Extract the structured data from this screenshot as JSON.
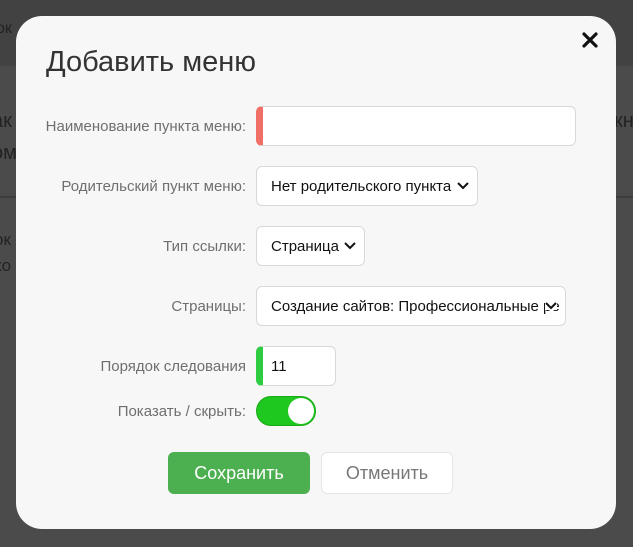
{
  "background": {
    "fragments": [
      "ок",
      "ак",
      "ом",
      "ок",
      "ко",
      "кн"
    ]
  },
  "modal": {
    "title": "Добавить меню",
    "close_icon": "close-icon"
  },
  "form": {
    "name_label": "Наименование пункта меню:",
    "name_value": "",
    "parent_label": "Родительский пункт меню:",
    "parent_value": "Нет родительского пункта",
    "link_type_label": "Тип ссылки:",
    "link_type_value": "Страница",
    "pages_label": "Страницы:",
    "pages_value": "Создание сайтов: Профессиональные ре",
    "order_label": "Порядок следования",
    "order_value": "11",
    "visibility_label": "Показать / скрыть:",
    "visibility_on": true
  },
  "buttons": {
    "save_label": "Сохранить",
    "cancel_label": "Отменить"
  },
  "colors": {
    "save": "#4caf50",
    "required_marker": "#f07068",
    "valid_marker": "#2ecc40",
    "toggle_on": "#1ec81e"
  }
}
